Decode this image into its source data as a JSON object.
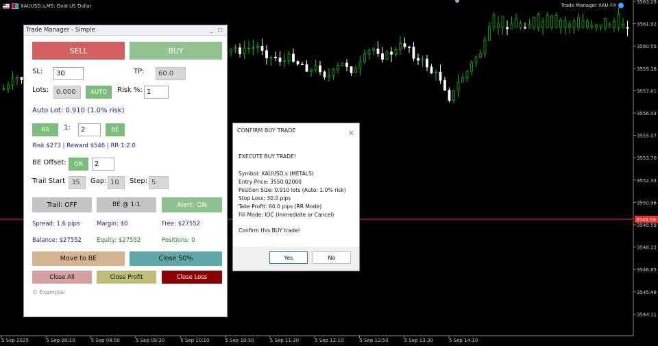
{
  "chart": {
    "symbol_label": "XAUUSD.s,M5:  Gold US Dollar",
    "ea_label": "Trade Manager XAU-FX",
    "price_labels": [
      "3563.29",
      "3561.92",
      "3560.55",
      "3559.18",
      "3557.81",
      "3556.44",
      "3555.07",
      "3553.70",
      "3552.33",
      "3550.96",
      "3549.59",
      "3548.22",
      "3546.85",
      "3545.48",
      "3544.11"
    ],
    "current_price": "3549.59",
    "time_labels": [
      "5 Sep 2025",
      "5 Sep 08:10",
      "5 Sep 08:50",
      "5 Sep 09:30",
      "5 Sep 10:10",
      "5 Sep 10:50",
      "5 Sep 11:30",
      "5 Sep 12:10",
      "5 Sep 12:50",
      "5 Sep 13:30",
      "5 Sep 14:10"
    ],
    "colors": {
      "bull": "#00c000",
      "bear": "#ffffff",
      "price_line": "#ff2a2a"
    }
  },
  "panel": {
    "title": "Trade Manager - Simple",
    "controls": "_ □",
    "sell": "SELL",
    "buy": "BUY",
    "sl_label": "SL:",
    "sl_value": "30",
    "tp_label": "TP:",
    "tp_value": "60.0",
    "lots_label": "Lots:",
    "lots_value": "0.000",
    "auto": "AUTO",
    "risk_label": "Risk %:",
    "risk_value": "1",
    "auto_lot": "Auto Lot: 0.910 (1.0% risk)",
    "rr_button": "RR",
    "rr_label": "1:",
    "rr_value": "2",
    "be_button": "BE",
    "risk_reward": "Risk $273 | Reward $546 | RR 1:2.0",
    "be_offset_label": "BE Offset:",
    "be_offset_state": "ON",
    "be_offset_value": "2",
    "trail_start_label": "Trail Start",
    "trail_start_value": "35",
    "gap_label": "Gap:",
    "gap_value": "10",
    "step_label": "Step:",
    "step_value": "5",
    "trail_off": "Trail: OFF",
    "be_11": "BE @ 1:1",
    "alert_on": "Alert: ON",
    "spread": "Spread: 1.6 pips",
    "margin": "Margin: $0",
    "free": "Free: $27552",
    "balance": "Balance: $27552",
    "equity": "Equity: $27552",
    "positions": "Positions: 0",
    "move_to_be": "Move to BE",
    "close_50": "Close 50%",
    "close_all": "Close All",
    "close_profit": "Close Profit",
    "close_loss": "Close Loss",
    "footer": "© Exemplar",
    "colors": {
      "sell": "#d45f5f",
      "buy": "#92c192",
      "small_green": "#7bbd7b",
      "gray_btn": "#c4c4c4",
      "alert": "#8fc08f",
      "move_be": "#d5b48f",
      "close50": "#5fa8a8",
      "close_all": "#d4a0a0",
      "close_profit": "#bfbd7a",
      "close_loss": "#8b0000",
      "navy": "#1a1a8c",
      "green": "#1f7a1f"
    }
  },
  "dialog": {
    "title": "CONFIRM BUY TRADE",
    "close": "✕",
    "lines": [
      "EXECUTE BUY TRADE!",
      "Symbol: XAUUSD.s (METALS)",
      "Entry Price: 3550.02000",
      "Position Size: 0.910 lots (Auto: 1.0% risk)",
      "Stop Loss: 30.0 pips",
      "Take Profit: 60.0 pips (RR Mode)",
      "Fill Mode: IOC (Immediate or Cancel)",
      "Confirm this BUY trade!"
    ],
    "yes": "Yes",
    "no": "No"
  }
}
